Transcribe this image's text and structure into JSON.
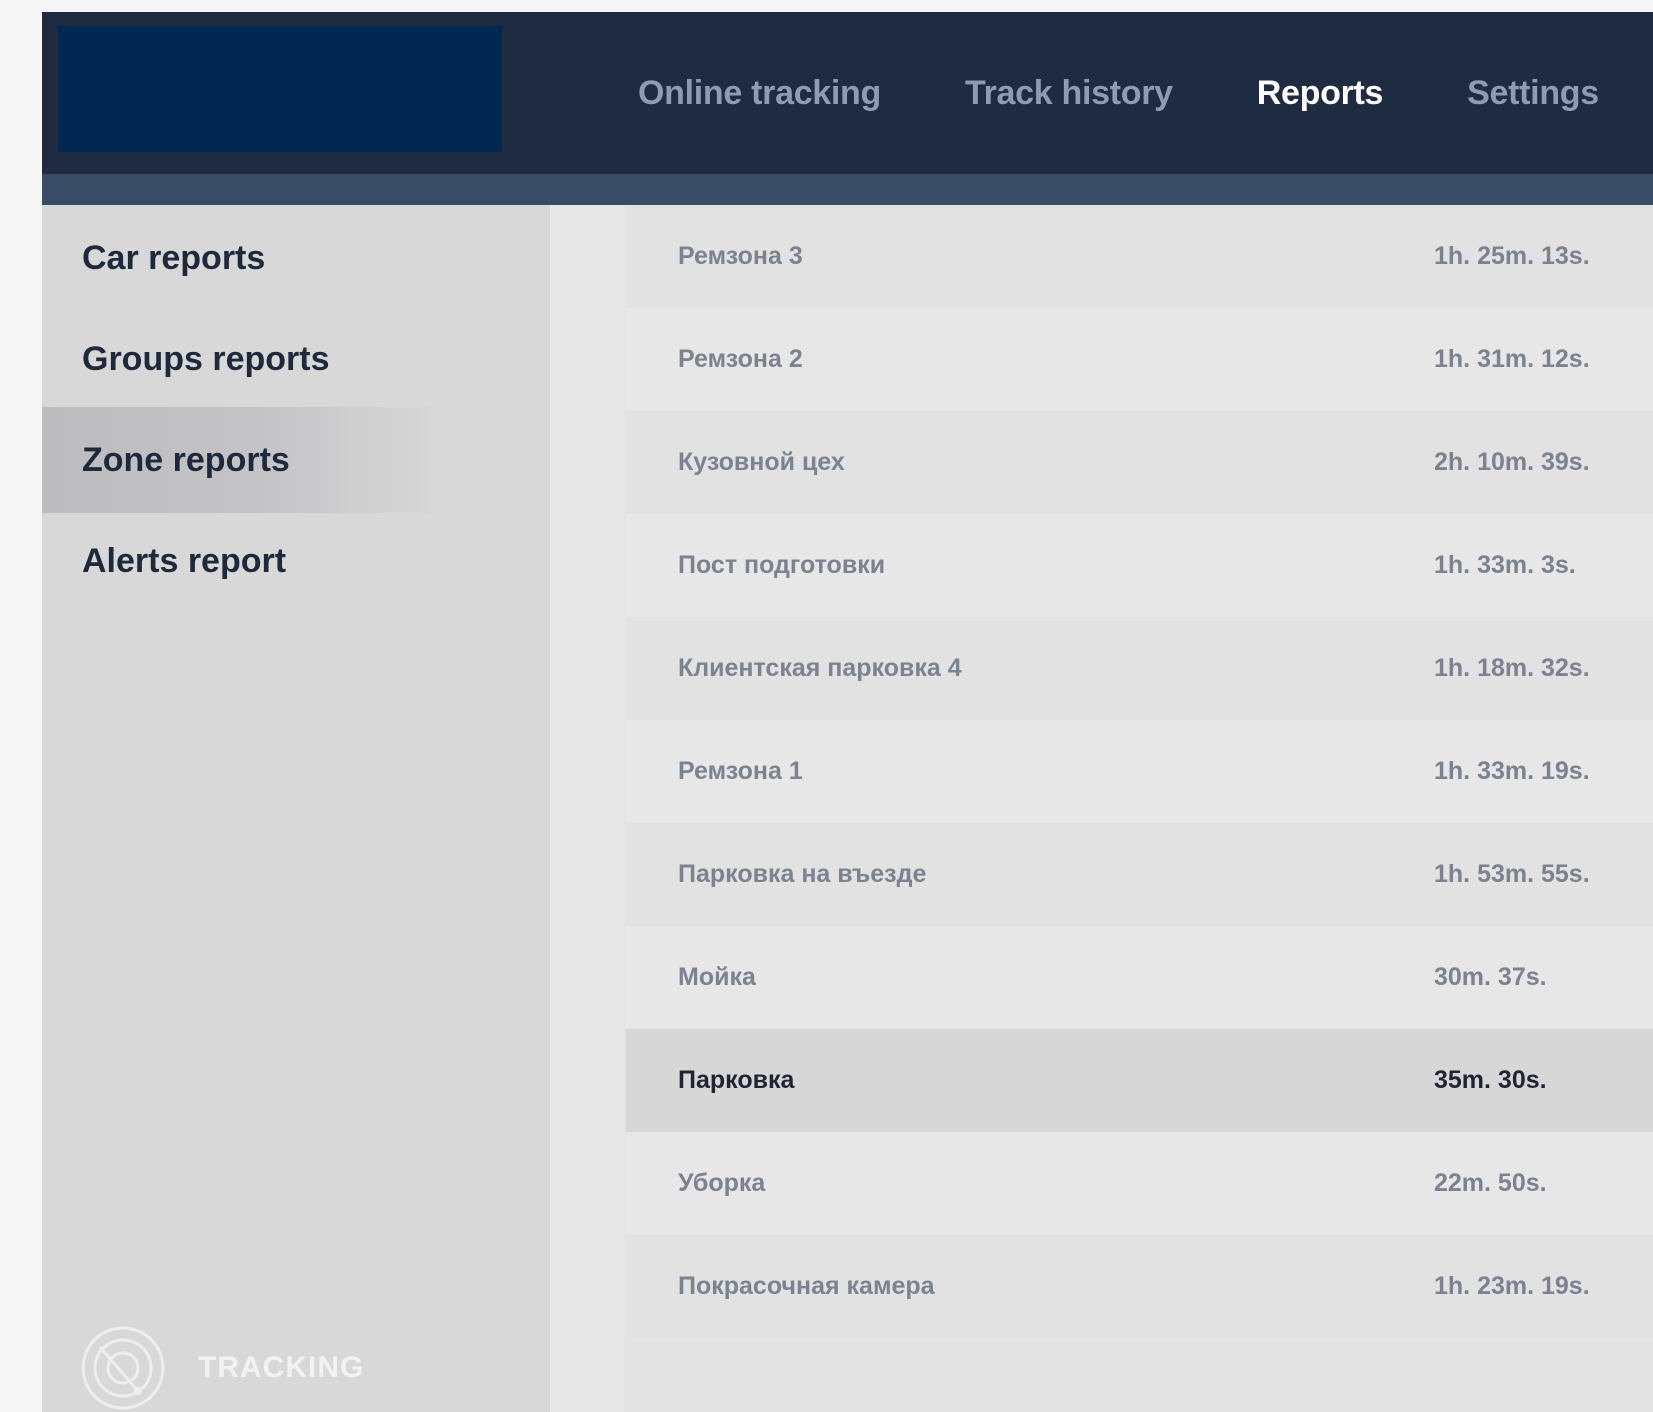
{
  "nav": {
    "items": [
      {
        "label": "Online tracking",
        "active": false
      },
      {
        "label": "Track history",
        "active": false
      },
      {
        "label": "Reports",
        "active": true
      },
      {
        "label": "Settings",
        "active": false
      }
    ]
  },
  "sidebar": {
    "items": [
      {
        "label": "Car reports",
        "active": false
      },
      {
        "label": "Groups reports",
        "active": false
      },
      {
        "label": "Zone reports",
        "active": true
      },
      {
        "label": "Alerts report",
        "active": false
      }
    ],
    "brand": {
      "text": "TRACKING",
      "icon": "radar-icon"
    }
  },
  "zones": [
    {
      "name": "Ремзона 3",
      "duration": "1h. 25m. 13s."
    },
    {
      "name": "Ремзона 2",
      "duration": "1h. 31m. 12s."
    },
    {
      "name": "Кузовной цех",
      "duration": "2h. 10m. 39s."
    },
    {
      "name": "Пост подготовки",
      "duration": "1h. 33m. 3s."
    },
    {
      "name": "Клиентская парковка 4",
      "duration": "1h. 18m. 32s."
    },
    {
      "name": "Ремзона 1",
      "duration": "1h. 33m. 19s."
    },
    {
      "name": "Парковка на въезде",
      "duration": "1h. 53m. 55s."
    },
    {
      "name": "Мойка",
      "duration": "30m. 37s."
    },
    {
      "name": "Парковка",
      "duration": "35m. 30s.",
      "selected": true
    },
    {
      "name": "Уборка",
      "duration": "22m. 50s."
    },
    {
      "name": "Покрасочная камера",
      "duration": "1h. 23m. 19s."
    }
  ],
  "colors": {
    "topbar": "#1f2b41",
    "logo_block": "#022750",
    "strip": "#3a4b65",
    "nav_inactive": "#8f9bb0",
    "nav_active": "#ffffff"
  }
}
